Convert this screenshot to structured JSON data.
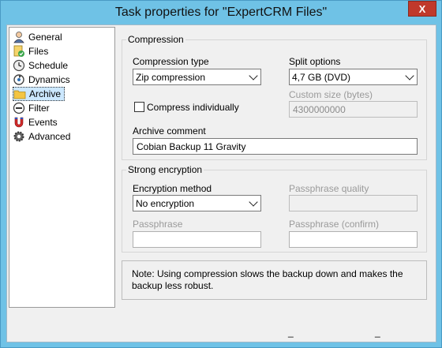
{
  "window": {
    "title": "Task properties for \"ExpertCRM Files\"",
    "close_label": "X"
  },
  "sidebar": {
    "items": [
      {
        "label": "General",
        "icon": "user-icon"
      },
      {
        "label": "Files",
        "icon": "files-icon"
      },
      {
        "label": "Schedule",
        "icon": "clock-icon"
      },
      {
        "label": "Dynamics",
        "icon": "dynamics-icon"
      },
      {
        "label": "Archive",
        "icon": "folder-icon",
        "selected": true
      },
      {
        "label": "Filter",
        "icon": "filter-icon"
      },
      {
        "label": "Events",
        "icon": "magnet-icon"
      },
      {
        "label": "Advanced",
        "icon": "gear-icon"
      }
    ]
  },
  "compression": {
    "legend": "Compression",
    "type_label": "Compression type",
    "type_value": "Zip compression",
    "split_label": "Split options",
    "split_value": "4,7 GB (DVD)",
    "custom_size_label": "Custom size (bytes)",
    "custom_size_value": "4300000000",
    "compress_individually_label": "Compress individually",
    "compress_individually_checked": false,
    "archive_comment_label": "Archive comment",
    "archive_comment_value": "Cobian Backup 11 Gravity"
  },
  "encryption": {
    "legend": "Strong encryption",
    "method_label": "Encryption method",
    "method_value": "No encryption",
    "quality_label": "Passphrase quality",
    "passphrase_label": "Passphrase",
    "passphrase_confirm_label": "Passphrase (confirm)"
  },
  "note": "Note: Using compression slows the backup down and makes the backup less robust.",
  "footer": {
    "ok_label": "_",
    "cancel_label": "_"
  }
}
